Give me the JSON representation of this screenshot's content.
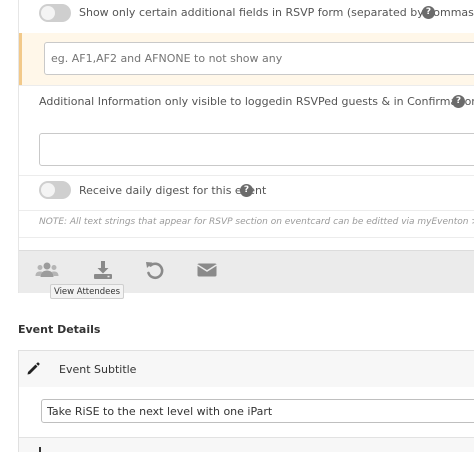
{
  "rsvp": {
    "additional_fields": {
      "label": "Show only certain additional fields in RSVP form (separated by commas)",
      "help": "?",
      "placeholder": "eg. AF1,AF2 and AFNONE to not show any",
      "value": ""
    },
    "additional_info": {
      "label": "Additional Information only visible to loggedin RSVPed guests & in Confirmation Email",
      "help": "?",
      "value": ""
    },
    "daily_digest": {
      "label": "Receive daily digest for this event",
      "help": "?"
    },
    "note": "NOTE: All text strings that appear for RSVP section on eventcard can be editted via myEventon > l"
  },
  "toolbar": {
    "icons": [
      "users-icon",
      "download-icon",
      "undo-icon",
      "envelope-icon"
    ],
    "tooltip": "View Attendees"
  },
  "event_details": {
    "title": "Event Details",
    "subtitle_label": "Event Subtitle",
    "subtitle_value": "Take RiSE to the next level with one iPart"
  },
  "colors": {
    "highlight_bg": "#fff7e9",
    "highlight_border": "#f2c98a",
    "toolbar_bg": "#ebebeb",
    "icon": "#8a8a8a"
  }
}
